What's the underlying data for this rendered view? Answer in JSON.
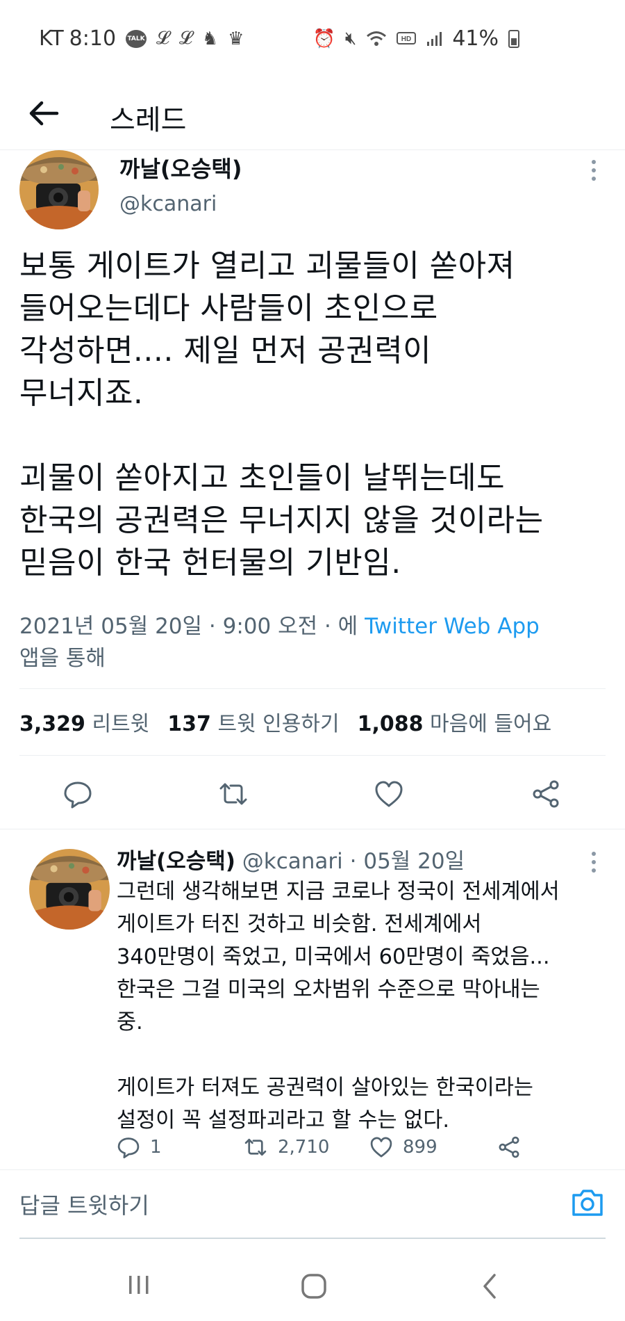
{
  "status_bar": {
    "carrier": "KT",
    "time": "8:10",
    "talk_badge": "TALK",
    "battery": "41%"
  },
  "header": {
    "title": "스레드"
  },
  "main_tweet": {
    "author_name": "까날(오승택)",
    "handle": "@kcanari",
    "text": "보통 게이트가 열리고 괴물들이 쏟아져\n들어오는데다 사람들이 초인으로\n각성하면.... 제일 먼저 공권력이\n무너지죠.\n\n괴물이 쏟아지고 초인들이 날뛰는데도\n한국의 공권력은 무너지지 않을 것이라는\n믿음이 한국 헌터물의 기반임.",
    "timestamp": "2021년 05월 20일 · 9:00 오전 · 에 ",
    "via": "Twitter Web App",
    "via_suffix": "앱을 통해",
    "retweets_count": "3,329",
    "retweets_label": "리트윗",
    "quotes_count": "137",
    "quotes_label": "트윗 인용하기",
    "likes_count": "1,088",
    "likes_label": "마음에 들어요"
  },
  "reply_tweet": {
    "author_name": "까날(오승택)",
    "handle": "@kcanari",
    "date": "· 05월 20일",
    "text": "그런데 생각해보면 지금 코로나 정국이 전세계에서\n게이트가 터진 것하고 비슷함. 전세계에서\n340만명이 죽었고, 미국에서 60만명이 죽었음...\n한국은 그걸 미국의 오차범위 수준으로 막아내는\n중.\n\n게이트가 터져도 공권력이 살아있는 한국이라는\n설정이 꼭 설정파괴라고 할 수는 없다.",
    "replies": "1",
    "retweets": "2,710",
    "likes": "899"
  },
  "reply_bar": {
    "placeholder": "답글 트윗하기"
  },
  "colors": {
    "accent": "#1d9bf0",
    "secondary_text": "#536471",
    "primary_text": "#0f1419"
  }
}
